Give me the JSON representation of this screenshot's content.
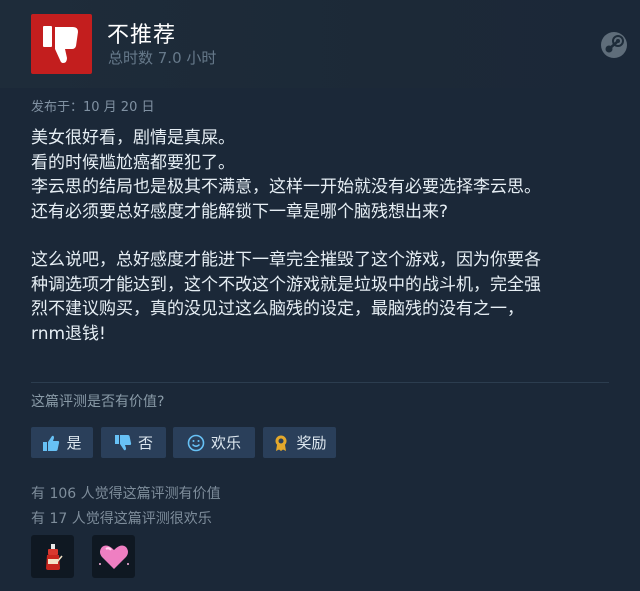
{
  "review": {
    "recommendation": "不推荐",
    "hours": "总时数 7.0 小时",
    "posted": "发布于：10 月 20 日",
    "lines": [
      "美女很好看，剧情是真屎。",
      "看的时候尴尬癌都要犯了。",
      "李云思的结局也是极其不满意，这样一开始就没有必要选择李云思。",
      "还有必须要总好感度才能解锁下一章是哪个脑残想出来?",
      "这么说吧，总好感度才能进下一章完全摧毁了这个游戏，因为你要各",
      "种调选项才能达到，这个不改这个游戏就是垃圾中的战斗机，完全强",
      "烈不建议购买，真的没见过这么脑残的设定，最脑残的没有之一，",
      "rnm退钱!"
    ]
  },
  "feedback": {
    "question": "这篇评测是否有价值?",
    "yes": "是",
    "no": "否",
    "funny": "欢乐",
    "award": "奖励",
    "helpful_count": "有 106 人觉得这篇评测有价值",
    "funny_count": "有 17 人觉得这篇评测很欢乐"
  },
  "icons": {
    "thumb": "thumb-down-icon",
    "logo": "steam-icon",
    "awards": [
      "hot-sauce-award-icon",
      "heart-award-icon"
    ]
  },
  "colors": {
    "negative": "#c31e1e",
    "button": "#2a3f5a",
    "background": "#1b2838"
  }
}
